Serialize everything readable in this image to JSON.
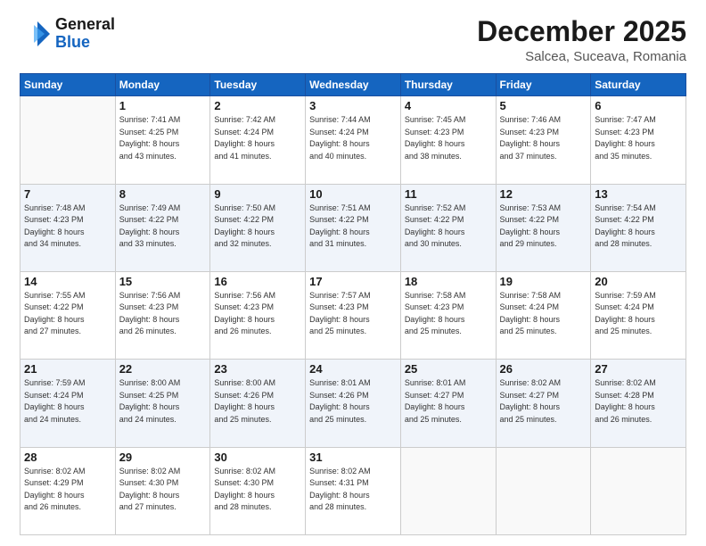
{
  "header": {
    "logo_general": "General",
    "logo_blue": "Blue",
    "month": "December 2025",
    "location": "Salcea, Suceava, Romania"
  },
  "days_of_week": [
    "Sunday",
    "Monday",
    "Tuesday",
    "Wednesday",
    "Thursday",
    "Friday",
    "Saturday"
  ],
  "weeks": [
    [
      {
        "day": "",
        "info": ""
      },
      {
        "day": "1",
        "info": "Sunrise: 7:41 AM\nSunset: 4:25 PM\nDaylight: 8 hours\nand 43 minutes."
      },
      {
        "day": "2",
        "info": "Sunrise: 7:42 AM\nSunset: 4:24 PM\nDaylight: 8 hours\nand 41 minutes."
      },
      {
        "day": "3",
        "info": "Sunrise: 7:44 AM\nSunset: 4:24 PM\nDaylight: 8 hours\nand 40 minutes."
      },
      {
        "day": "4",
        "info": "Sunrise: 7:45 AM\nSunset: 4:23 PM\nDaylight: 8 hours\nand 38 minutes."
      },
      {
        "day": "5",
        "info": "Sunrise: 7:46 AM\nSunset: 4:23 PM\nDaylight: 8 hours\nand 37 minutes."
      },
      {
        "day": "6",
        "info": "Sunrise: 7:47 AM\nSunset: 4:23 PM\nDaylight: 8 hours\nand 35 minutes."
      }
    ],
    [
      {
        "day": "7",
        "info": "Sunrise: 7:48 AM\nSunset: 4:23 PM\nDaylight: 8 hours\nand 34 minutes."
      },
      {
        "day": "8",
        "info": "Sunrise: 7:49 AM\nSunset: 4:22 PM\nDaylight: 8 hours\nand 33 minutes."
      },
      {
        "day": "9",
        "info": "Sunrise: 7:50 AM\nSunset: 4:22 PM\nDaylight: 8 hours\nand 32 minutes."
      },
      {
        "day": "10",
        "info": "Sunrise: 7:51 AM\nSunset: 4:22 PM\nDaylight: 8 hours\nand 31 minutes."
      },
      {
        "day": "11",
        "info": "Sunrise: 7:52 AM\nSunset: 4:22 PM\nDaylight: 8 hours\nand 30 minutes."
      },
      {
        "day": "12",
        "info": "Sunrise: 7:53 AM\nSunset: 4:22 PM\nDaylight: 8 hours\nand 29 minutes."
      },
      {
        "day": "13",
        "info": "Sunrise: 7:54 AM\nSunset: 4:22 PM\nDaylight: 8 hours\nand 28 minutes."
      }
    ],
    [
      {
        "day": "14",
        "info": "Sunrise: 7:55 AM\nSunset: 4:22 PM\nDaylight: 8 hours\nand 27 minutes."
      },
      {
        "day": "15",
        "info": "Sunrise: 7:56 AM\nSunset: 4:23 PM\nDaylight: 8 hours\nand 26 minutes."
      },
      {
        "day": "16",
        "info": "Sunrise: 7:56 AM\nSunset: 4:23 PM\nDaylight: 8 hours\nand 26 minutes."
      },
      {
        "day": "17",
        "info": "Sunrise: 7:57 AM\nSunset: 4:23 PM\nDaylight: 8 hours\nand 25 minutes."
      },
      {
        "day": "18",
        "info": "Sunrise: 7:58 AM\nSunset: 4:23 PM\nDaylight: 8 hours\nand 25 minutes."
      },
      {
        "day": "19",
        "info": "Sunrise: 7:58 AM\nSunset: 4:24 PM\nDaylight: 8 hours\nand 25 minutes."
      },
      {
        "day": "20",
        "info": "Sunrise: 7:59 AM\nSunset: 4:24 PM\nDaylight: 8 hours\nand 25 minutes."
      }
    ],
    [
      {
        "day": "21",
        "info": "Sunrise: 7:59 AM\nSunset: 4:24 PM\nDaylight: 8 hours\nand 24 minutes."
      },
      {
        "day": "22",
        "info": "Sunrise: 8:00 AM\nSunset: 4:25 PM\nDaylight: 8 hours\nand 24 minutes."
      },
      {
        "day": "23",
        "info": "Sunrise: 8:00 AM\nSunset: 4:26 PM\nDaylight: 8 hours\nand 25 minutes."
      },
      {
        "day": "24",
        "info": "Sunrise: 8:01 AM\nSunset: 4:26 PM\nDaylight: 8 hours\nand 25 minutes."
      },
      {
        "day": "25",
        "info": "Sunrise: 8:01 AM\nSunset: 4:27 PM\nDaylight: 8 hours\nand 25 minutes."
      },
      {
        "day": "26",
        "info": "Sunrise: 8:02 AM\nSunset: 4:27 PM\nDaylight: 8 hours\nand 25 minutes."
      },
      {
        "day": "27",
        "info": "Sunrise: 8:02 AM\nSunset: 4:28 PM\nDaylight: 8 hours\nand 26 minutes."
      }
    ],
    [
      {
        "day": "28",
        "info": "Sunrise: 8:02 AM\nSunset: 4:29 PM\nDaylight: 8 hours\nand 26 minutes."
      },
      {
        "day": "29",
        "info": "Sunrise: 8:02 AM\nSunset: 4:30 PM\nDaylight: 8 hours\nand 27 minutes."
      },
      {
        "day": "30",
        "info": "Sunrise: 8:02 AM\nSunset: 4:30 PM\nDaylight: 8 hours\nand 28 minutes."
      },
      {
        "day": "31",
        "info": "Sunrise: 8:02 AM\nSunset: 4:31 PM\nDaylight: 8 hours\nand 28 minutes."
      },
      {
        "day": "",
        "info": ""
      },
      {
        "day": "",
        "info": ""
      },
      {
        "day": "",
        "info": ""
      }
    ]
  ]
}
